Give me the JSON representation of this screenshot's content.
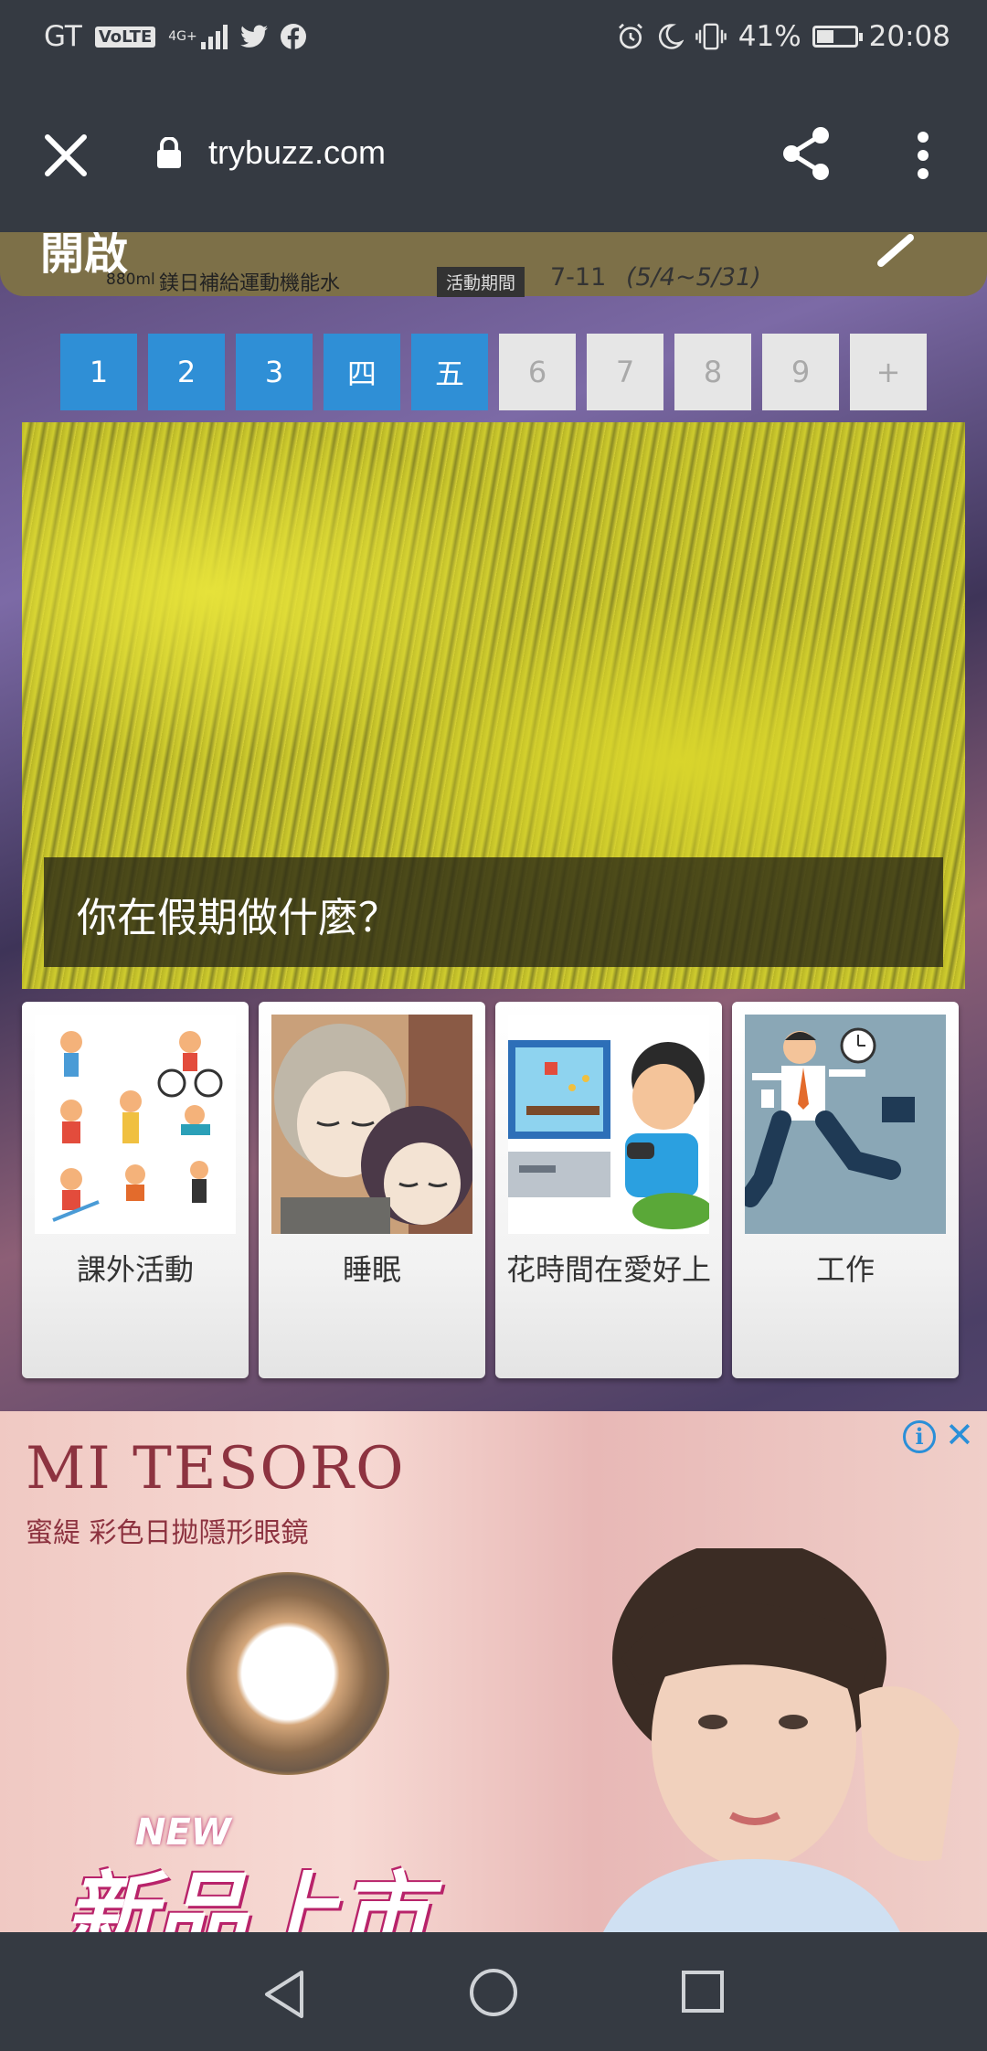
{
  "status_bar": {
    "carrier": "GT",
    "volte": "VoLTE",
    "network": "4G+",
    "battery_percent": "41%",
    "battery_level": 0.41,
    "time": "20:08",
    "icons": [
      "twitter-icon",
      "facebook-icon",
      "alarm-icon",
      "moon-icon",
      "vibrate-icon",
      "battery-icon"
    ]
  },
  "toolbar": {
    "url": "trybuzz.com",
    "close_icon": "close-icon",
    "lock_icon": "lock-icon",
    "share_icon": "share-icon",
    "menu_icon": "more-vert-icon"
  },
  "top_banner": {
    "headline": "開啟",
    "volume": "880ml",
    "subtitle": "鎂日補給運動機能水",
    "period_tag": "活動期間",
    "promo": "7-11",
    "dates": "(5/4~5/31)"
  },
  "pager": {
    "pages": [
      "1",
      "2",
      "3",
      "四",
      "五",
      "6",
      "7",
      "8",
      "9",
      "+"
    ],
    "active_count": 5
  },
  "hero": {
    "caption": "你在假期做什麼？"
  },
  "options": [
    {
      "label": "課外活動"
    },
    {
      "label": "睡眠"
    },
    {
      "label": "花時間在愛好上"
    },
    {
      "label": "工作"
    }
  ],
  "ad": {
    "brand": "MI TESORO",
    "subtitle": "蜜緹 彩色日拋隱形眼鏡",
    "new_tag": "NEW",
    "title": "新品上市",
    "info_icon": "info-icon",
    "close_icon": "close-icon"
  },
  "nav": {
    "back_icon": "back-triangle-icon",
    "home_icon": "home-circle-icon",
    "recent_icon": "recent-square-icon"
  }
}
